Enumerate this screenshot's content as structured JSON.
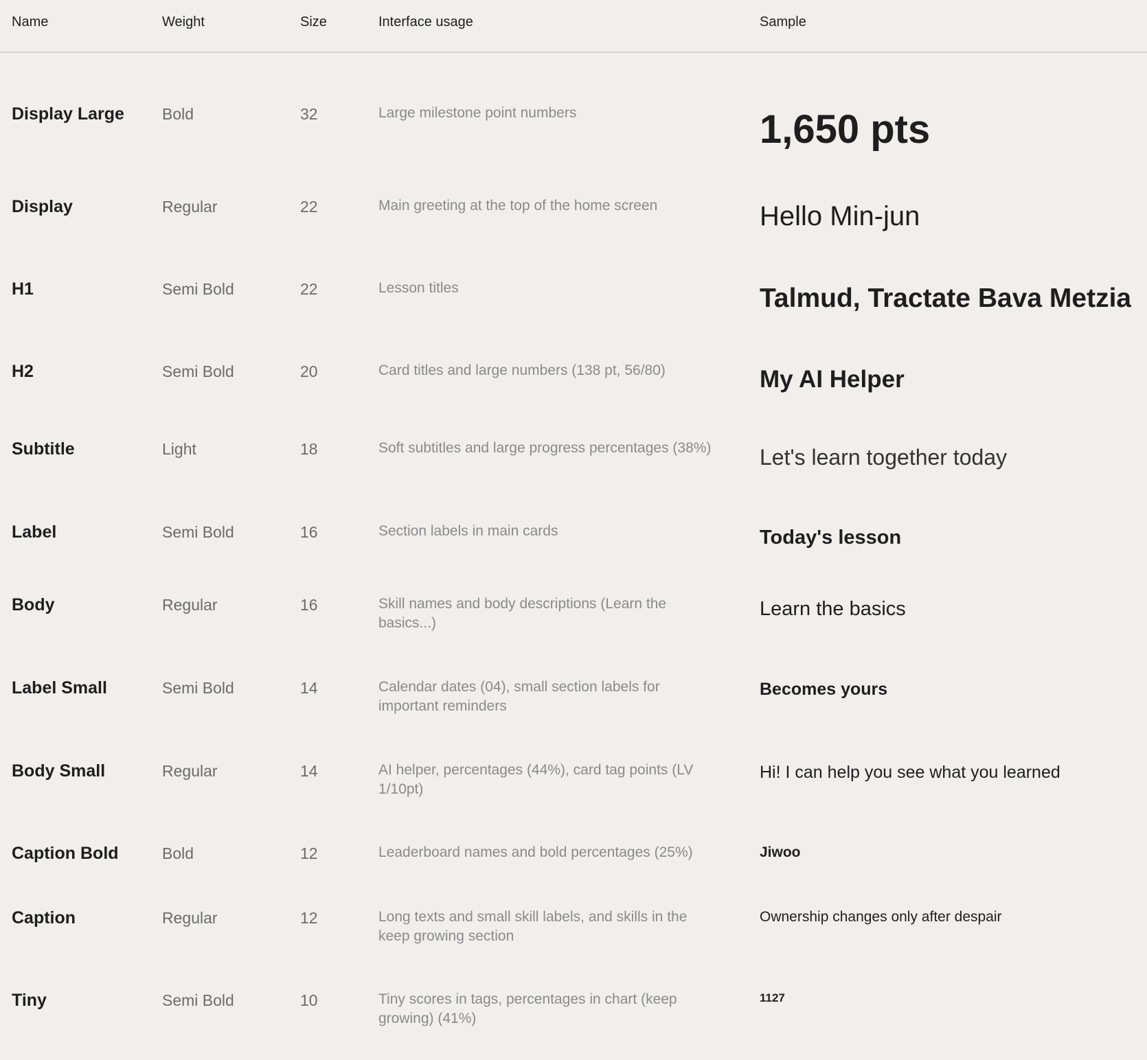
{
  "columns": {
    "name": "Name",
    "weight": "Weight",
    "size": "Size",
    "usage": "Interface usage",
    "sample": "Sample"
  },
  "rows": [
    {
      "name": "Display Large",
      "weight": "Bold",
      "size": "32",
      "usage": "Large milestone point numbers",
      "sample": "1,650 pts"
    },
    {
      "name": "Display",
      "weight": "Regular",
      "size": "22",
      "usage": "Main greeting at the top of the home screen",
      "sample": "Hello Min-jun"
    },
    {
      "name": "H1",
      "weight": "Semi Bold",
      "size": "22",
      "usage": "Lesson titles",
      "sample": "Talmud, Tractate Bava Metzia"
    },
    {
      "name": "H2",
      "weight": "Semi Bold",
      "size": "20",
      "usage": "Card titles and large numbers (138 pt, 56/80)",
      "sample": "My AI Helper"
    },
    {
      "name": "Subtitle",
      "weight": "Light",
      "size": "18",
      "usage": "Soft subtitles and large progress percentages (38%)",
      "sample": "Let's learn together today"
    },
    {
      "name": "Label",
      "weight": "Semi Bold",
      "size": "16",
      "usage": "Section labels in main cards",
      "sample": "Today's lesson"
    },
    {
      "name": "Body",
      "weight": "Regular",
      "size": "16",
      "usage": "Skill names and body descriptions (Learn the basics...)",
      "sample": "Learn the basics"
    },
    {
      "name": "Label Small",
      "weight": "Semi Bold",
      "size": "14",
      "usage": "Calendar dates (04), small section labels for important reminders",
      "sample": "Becomes yours"
    },
    {
      "name": "Body Small",
      "weight": "Regular",
      "size": "14",
      "usage": "AI helper, percentages (44%), card tag points (LV 1/10pt)",
      "sample": "Hi! I can help you see what you learned"
    },
    {
      "name": "Caption Bold",
      "weight": "Bold",
      "size": "12",
      "usage": "Leaderboard names and bold percentages (25%)",
      "sample": "Jiwoo"
    },
    {
      "name": "Caption",
      "weight": "Regular",
      "size": "12",
      "usage": "Long texts and small skill labels, and skills in the keep growing section",
      "sample": "Ownership changes only after despair"
    },
    {
      "name": "Tiny",
      "weight": "Semi Bold",
      "size": "10",
      "usage": "Tiny scores in tags, percentages in chart (keep growing) (41%)",
      "sample": "1127"
    }
  ]
}
